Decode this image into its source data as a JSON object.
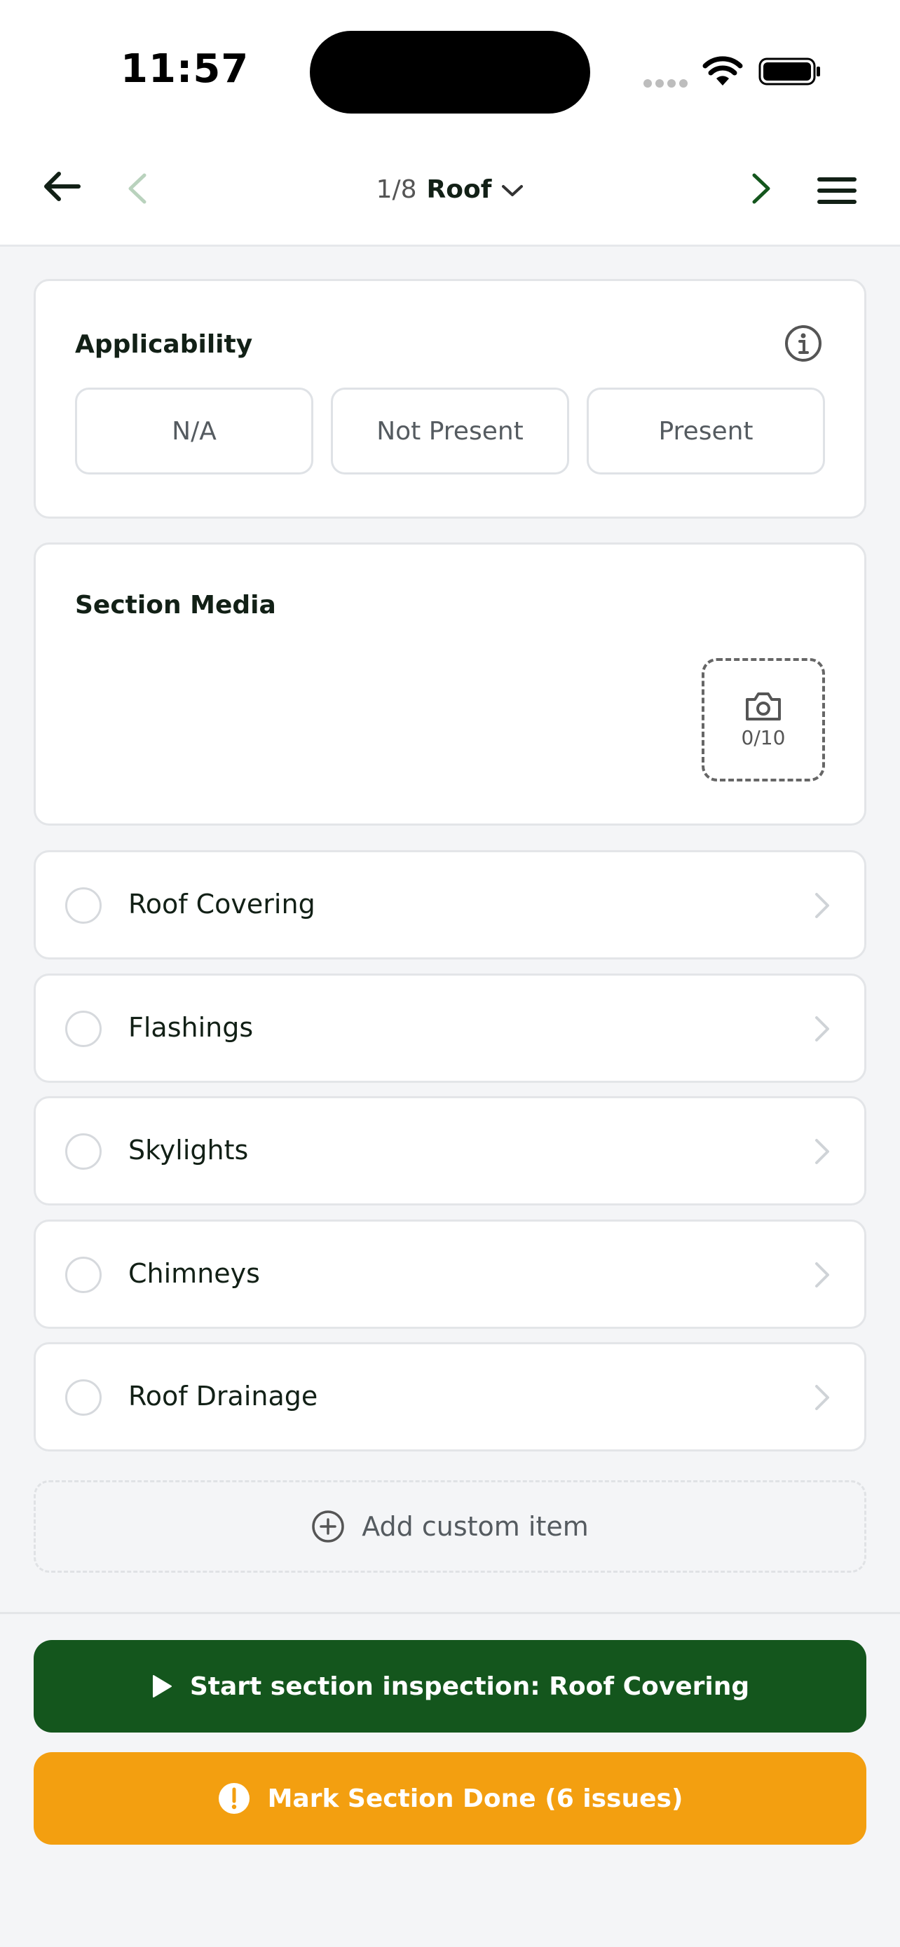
{
  "status_bar": {
    "time": "11:57"
  },
  "nav": {
    "section_count": "1/8",
    "section_name": "Roof"
  },
  "applicability": {
    "title": "Applicability",
    "options": [
      "N/A",
      "Not Present",
      "Present"
    ]
  },
  "section_media": {
    "title": "Section Media",
    "photo_count": "0/10"
  },
  "items": [
    {
      "label": "Roof Covering"
    },
    {
      "label": "Flashings"
    },
    {
      "label": "Skylights"
    },
    {
      "label": "Chimneys"
    },
    {
      "label": "Roof Drainage"
    }
  ],
  "add_custom_label": "Add custom item",
  "actions": {
    "start_label": "Start section inspection: Roof Covering",
    "done_label": "Mark Section Done (6 issues)"
  },
  "colors": {
    "primary_green": "#14561d",
    "warning_orange": "#f39f10"
  }
}
